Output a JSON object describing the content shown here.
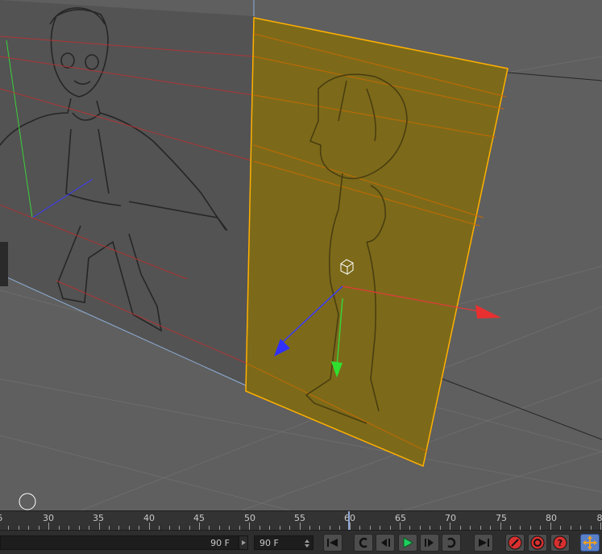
{
  "viewport": {
    "background": "#5f5f5f",
    "grid_color": "#6e6e6e",
    "selected_plane_color": "#c8a000",
    "selected_outline_color": "#ffb000",
    "axis_colors": {
      "x": "#e33a3a",
      "y": "#3ad13a",
      "z": "#3a3aff"
    },
    "icons": [
      "object-cube-icon",
      "move-gizmo-icon",
      "cursor-circle-icon"
    ]
  },
  "timeline": {
    "ticks": [
      "5",
      "30",
      "35",
      "40",
      "45",
      "50",
      "55",
      "60",
      "65",
      "70",
      "75",
      "80",
      "8"
    ],
    "current_frame": 58
  },
  "controls": {
    "end_frame_display": "90 F",
    "end_frame_field": "90 F",
    "buttons": [
      {
        "name": "go-to-start",
        "icon": "skip-start-icon"
      },
      {
        "name": "step-back",
        "icon": "loop-back-icon"
      },
      {
        "name": "previous-key",
        "icon": "prev-key-icon"
      },
      {
        "name": "play",
        "icon": "play-icon"
      },
      {
        "name": "next-key",
        "icon": "next-key-icon"
      },
      {
        "name": "step-forward",
        "icon": "loop-forward-icon"
      },
      {
        "name": "go-to-end",
        "icon": "skip-end-icon"
      },
      {
        "name": "record",
        "icon": "record-key-icon"
      },
      {
        "name": "autokey",
        "icon": "autokey-icon"
      },
      {
        "name": "key-help",
        "icon": "help-key-icon"
      },
      {
        "name": "move-tool",
        "icon": "move-arrows-icon"
      }
    ]
  }
}
